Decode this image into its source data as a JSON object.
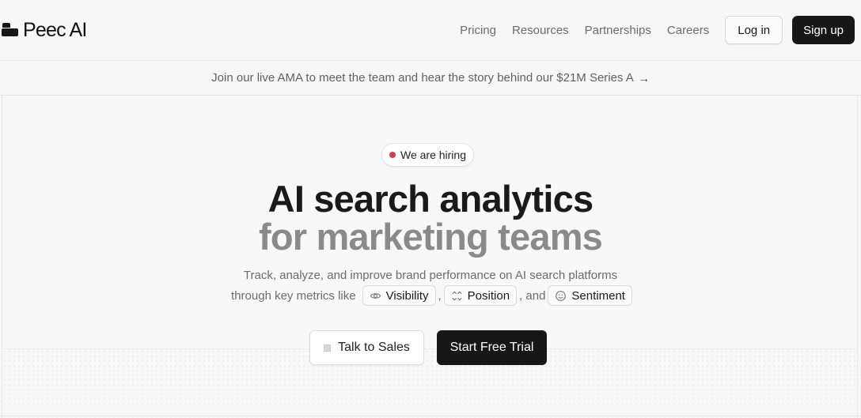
{
  "brand": {
    "name": "Peec AI"
  },
  "nav": {
    "links": [
      "Pricing",
      "Resources",
      "Partnerships",
      "Careers"
    ],
    "login_label": "Log in",
    "signup_label": "Sign up"
  },
  "announcement": {
    "text": "Join our live AMA to meet the team and hear the story behind our $21M Series A",
    "arrow": "→"
  },
  "hero": {
    "badge": "We are hiring",
    "badge_dot_color": "#d6404e",
    "title_line1": "AI search analytics",
    "title_line2": "for marketing teams",
    "subtitle_line1": "Track, analyze, and improve brand performance on AI search platforms",
    "subtitle_prefix": "through key metrics like",
    "metrics": [
      {
        "label": "Visibility",
        "icon": "eye-icon"
      },
      {
        "label": "Position",
        "icon": "position-icon"
      },
      {
        "label": "Sentiment",
        "icon": "smiley-icon"
      }
    ],
    "comma": ",",
    "comma_and": ", and",
    "cta_secondary": "Talk to Sales",
    "cta_primary": "Start Free Trial"
  },
  "colors": {
    "primary": "#171717",
    "muted_text": "#6b6b6b",
    "title_secondary": "#8a8a8a",
    "background": "#f7f7f7"
  }
}
